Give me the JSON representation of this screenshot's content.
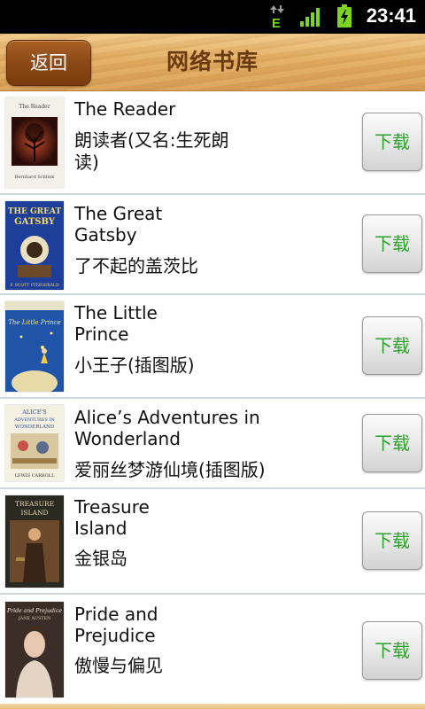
{
  "status_bar": {
    "time": "23:41",
    "network_label": "E",
    "icons": [
      "data-transfer-icon",
      "signal-icon",
      "battery-charging-icon"
    ]
  },
  "header": {
    "back_label": "返回",
    "title": "网络书库"
  },
  "colors": {
    "title_text": "#6a3a10",
    "back_button": "#8a4714",
    "download_text": "#2ea12e",
    "network_e": "#7cd321"
  },
  "books": [
    {
      "title_en": "The Reader",
      "title_cn": "朗读者(又名:生死朗读)",
      "download_label": "下载",
      "cover_text": [
        "The Reader",
        "Bernhard Schlink"
      ]
    },
    {
      "title_en": "The Great Gatsby",
      "title_cn": "了不起的盖茨比",
      "download_label": "下载",
      "cover_text": [
        "THE GREAT GATSBY",
        "F. SCOTT FITZGERALD"
      ]
    },
    {
      "title_en": "The Little Prince",
      "title_cn": "小王子(插图版)",
      "download_label": "下载",
      "cover_text": [
        "The Little Prince"
      ]
    },
    {
      "title_en": "Alice’s Adventures in Wonderland",
      "title_cn": "爱丽丝梦游仙境(插图版)",
      "download_label": "下载",
      "cover_text": [
        "ALICE'S ADVENTURES IN WONDERLAND",
        "LEWIS CARROLL"
      ]
    },
    {
      "title_en": "Treasure Island",
      "title_cn": "金银岛",
      "download_label": "下载",
      "cover_text": [
        "TREASURE ISLAND"
      ]
    },
    {
      "title_en": "Pride and Prejudice",
      "title_cn": "傲慢与偏见",
      "download_label": "下载",
      "cover_text": [
        "Pride and Prejudice",
        "JANE AUSTEN"
      ]
    }
  ]
}
